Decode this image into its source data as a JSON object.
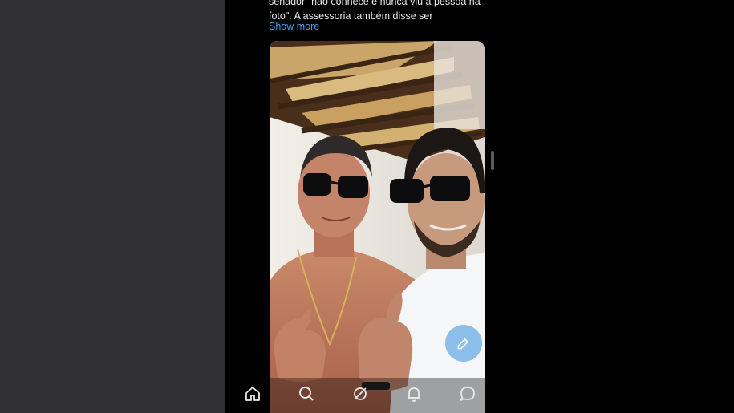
{
  "post": {
    "text_lines": [
      "senador \"não conhece e nunca viu a pessoa na",
      "foto\". A assessoria também disse ser"
    ],
    "show_more_label": "Show more"
  },
  "media": {
    "description_icon": "photo",
    "image_kind": "selfie-photo"
  },
  "fab": {
    "icon": "compose-icon",
    "color": "#78b4e6"
  },
  "bottom_nav": {
    "items": [
      {
        "name": "home",
        "icon": "home-icon"
      },
      {
        "name": "search",
        "icon": "search-icon"
      },
      {
        "name": "grok",
        "icon": "grok-icon"
      },
      {
        "name": "notifications",
        "icon": "bell-icon"
      },
      {
        "name": "messages",
        "icon": "chat-icon"
      }
    ]
  },
  "colors": {
    "left_background": "#303033",
    "phone_background": "#000000",
    "text": "#e7e9ea",
    "link": "#4a9ee8"
  }
}
